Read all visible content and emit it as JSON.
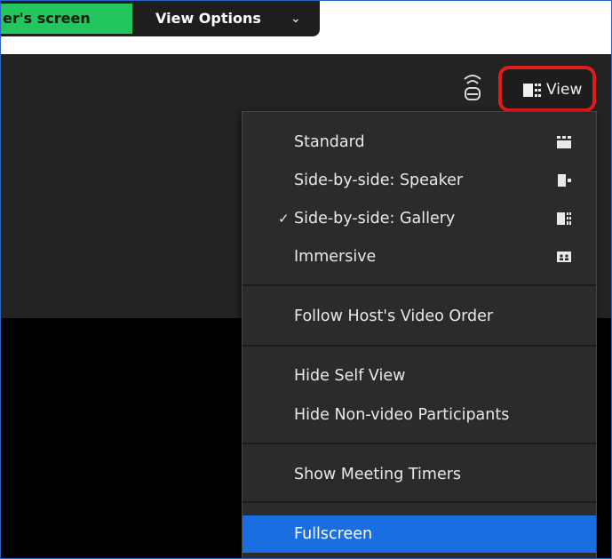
{
  "top_strip": {
    "share_label": "er's screen",
    "view_options_label": "View Options",
    "chevron": "⌄",
    "share_color": "#22c55e"
  },
  "toolbar": {
    "signal_icon": "signal-icon",
    "view_label": "View",
    "view_icon": "gallery-layout-icon",
    "highlight_border_color": "#e21b1b"
  },
  "view_menu": {
    "layouts": [
      {
        "label": "Standard",
        "icon": "standard-layout-icon",
        "checked": false
      },
      {
        "label": "Side-by-side: Speaker",
        "icon": "speaker-layout-icon",
        "checked": false
      },
      {
        "label": "Side-by-side: Gallery",
        "icon": "gallery-layout-icon",
        "checked": true
      },
      {
        "label": "Immersive",
        "icon": "immersive-layout-icon",
        "checked": false
      }
    ],
    "check_mark": "✓",
    "follow_host_label": "Follow Host's Video Order",
    "hide_self_label": "Hide Self View",
    "hide_nonvideo_label": "Hide Non-video Participants",
    "show_timers_label": "Show Meeting Timers",
    "fullscreen_label": "Fullscreen",
    "highlight_color": "#1a6fe0"
  }
}
